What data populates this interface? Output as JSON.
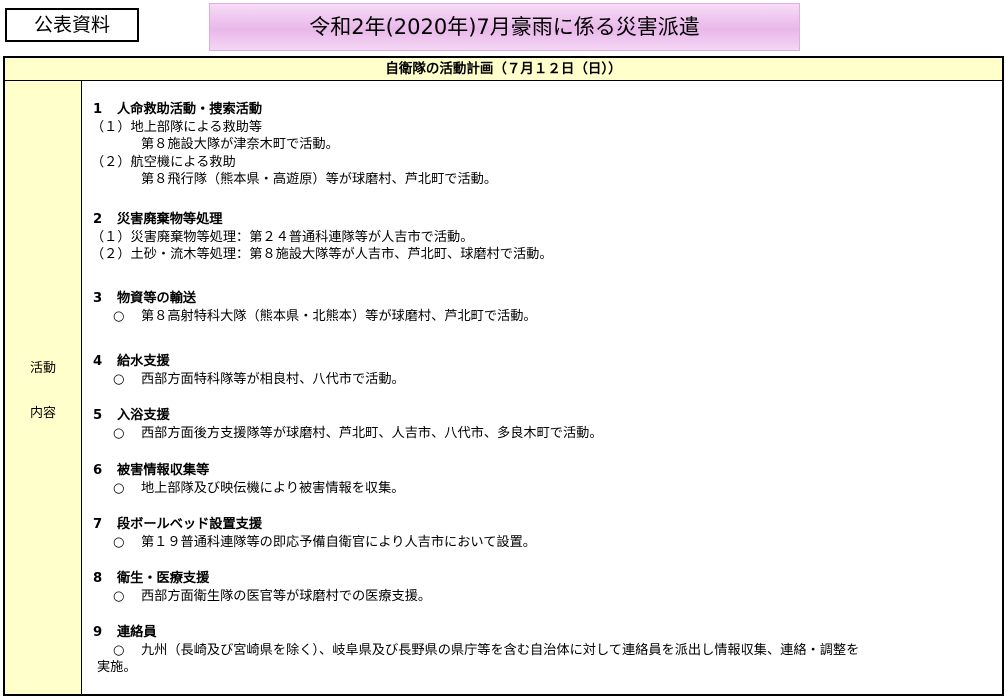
{
  "tag": "公表資料",
  "banner_title": "令和2年(2020年)7月豪雨に係る災害派遣",
  "table_header": "自衛隊の活動計画（７月１２日（日））",
  "side_labels": [
    "活動",
    "内容"
  ],
  "sections": [
    {
      "num": "1",
      "title": "人命救助活動・捜索活動",
      "subs": [
        {
          "label": "（１）地上部隊による救助等",
          "detail": "第８施設大隊が津奈木町で活動。"
        },
        {
          "label": "（２）航空機による救助",
          "detail": "第８飛行隊（熊本県・高遊原）等が球磨村、芦北町で活動。"
        }
      ]
    },
    {
      "num": "2",
      "title": "災害廃棄物等処理",
      "lines": [
        "（１）災害廃棄物等処理：第２４普通科連隊等が人吉市で活動。",
        "（２）土砂・流木等処理：第８施設大隊等が人吉市、芦北町、球磨村で活動。"
      ]
    },
    {
      "num": "3",
      "title": "物資等の輸送",
      "bullet": "○",
      "text": "第８高射特科大隊（熊本県・北熊本）等が球磨村、芦北町で活動。"
    },
    {
      "num": "4",
      "title": "給水支援",
      "bullet": "○",
      "text": "西部方面特科隊等が相良村、八代市で活動。"
    },
    {
      "num": "5",
      "title": "入浴支援",
      "bullet": "○",
      "text": "西部方面後方支援隊等が球磨村、芦北町、人吉市、八代市、多良木町で活動。"
    },
    {
      "num": "6",
      "title": "被害情報収集等",
      "bullet": "○",
      "text": "地上部隊及び映伝機により被害情報を収集。"
    },
    {
      "num": "7",
      "title": "段ボールベッド設置支援",
      "bullet": "○",
      "text": "第１９普通科連隊等の即応予備自衛官により人吉市において設置。"
    },
    {
      "num": "8",
      "title": "衛生・医療支援",
      "bullet": "○",
      "text": "西部方面衛生隊の医官等が球磨村での医療支援。"
    },
    {
      "num": "9",
      "title": "連絡員",
      "bullet": "○",
      "text": "九州（長崎及び宮崎県を除く）、岐阜県及び長野県の県庁等を含む自治体に対して連絡員を派出し情報収集、連絡・調整を",
      "text_cont": "実施。"
    }
  ]
}
